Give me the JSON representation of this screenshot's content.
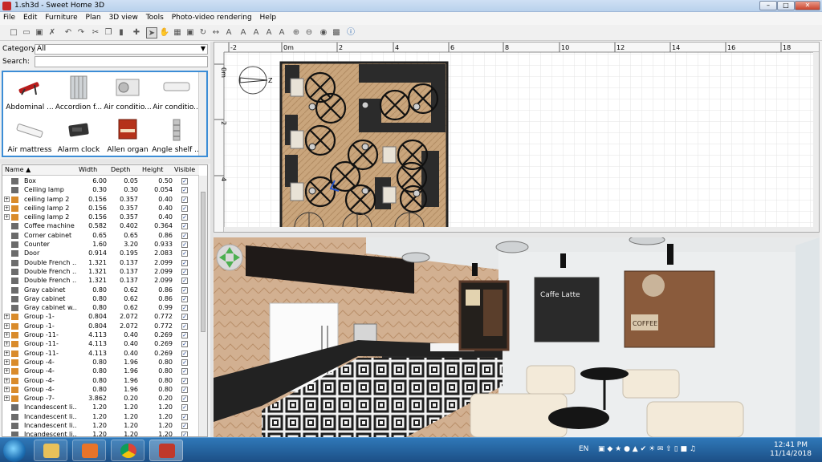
{
  "window": {
    "title": "1.sh3d - Sweet Home 3D",
    "minimize_label": "–",
    "maximize_label": "□",
    "close_label": "✕"
  },
  "menu": [
    "File",
    "Edit",
    "Furniture",
    "Plan",
    "3D view",
    "Tools",
    "Photo-video rendering",
    "Help"
  ],
  "colors": {
    "accent": "#3c8dd6",
    "plan_floor": "#c8a27a",
    "taskbar": "#1c4f86"
  },
  "catalog": {
    "category_label": "Category:",
    "category_value": "All",
    "search_label": "Search:",
    "search_value": "",
    "items": [
      {
        "label": "Abdominal ...",
        "icon": "abdominal-bench-icon"
      },
      {
        "label": "Accordion f...",
        "icon": "accordion-door-icon"
      },
      {
        "label": "Air conditio...",
        "icon": "air-conditioner-outdoor-icon"
      },
      {
        "label": "Air conditio...",
        "icon": "air-conditioner-indoor-icon"
      },
      {
        "label": "Air mattress",
        "icon": "air-mattress-icon"
      },
      {
        "label": "Alarm clock",
        "icon": "alarm-clock-icon"
      },
      {
        "label": "Allen organ",
        "icon": "organ-icon"
      },
      {
        "label": "Angle shelf ...",
        "icon": "angle-shelf-icon"
      }
    ]
  },
  "furniture_table": {
    "headers": {
      "name": "Name ▲",
      "width": "Width",
      "depth": "Depth",
      "height": "Height",
      "visible": "Visible"
    },
    "rows": [
      {
        "name": "Box",
        "width": "6.00",
        "depth": "0.05",
        "height": "0.50",
        "group": false
      },
      {
        "name": "Ceiling lamp",
        "width": "0.30",
        "depth": "0.30",
        "height": "0.054",
        "group": false
      },
      {
        "name": "ceiling lamp 2",
        "width": "0.156",
        "depth": "0.357",
        "height": "0.40",
        "group": true
      },
      {
        "name": "ceiling lamp 2",
        "width": "0.156",
        "depth": "0.357",
        "height": "0.40",
        "group": true
      },
      {
        "name": "ceiling lamp 2",
        "width": "0.156",
        "depth": "0.357",
        "height": "0.40",
        "group": true
      },
      {
        "name": "Coffee machine",
        "width": "0.582",
        "depth": "0.402",
        "height": "0.364",
        "group": false
      },
      {
        "name": "Corner cabinet",
        "width": "0.65",
        "depth": "0.65",
        "height": "0.86",
        "group": false
      },
      {
        "name": "Counter",
        "width": "1.60",
        "depth": "3.20",
        "height": "0.933",
        "group": false
      },
      {
        "name": "Door",
        "width": "0.914",
        "depth": "0.195",
        "height": "2.083",
        "group": false
      },
      {
        "name": "Double French ...",
        "width": "1.321",
        "depth": "0.137",
        "height": "2.099",
        "group": false
      },
      {
        "name": "Double French ...",
        "width": "1.321",
        "depth": "0.137",
        "height": "2.099",
        "group": false
      },
      {
        "name": "Double French ...",
        "width": "1.321",
        "depth": "0.137",
        "height": "2.099",
        "group": false
      },
      {
        "name": "Gray cabinet",
        "width": "0.80",
        "depth": "0.62",
        "height": "0.86",
        "group": false
      },
      {
        "name": "Gray cabinet",
        "width": "0.80",
        "depth": "0.62",
        "height": "0.86",
        "group": false
      },
      {
        "name": "Gray cabinet w...",
        "width": "0.80",
        "depth": "0.62",
        "height": "0.99",
        "group": false
      },
      {
        "name": "Group -1-",
        "width": "0.804",
        "depth": "2.072",
        "height": "0.772",
        "group": true
      },
      {
        "name": "Group -1-",
        "width": "0.804",
        "depth": "2.072",
        "height": "0.772",
        "group": true
      },
      {
        "name": "Group -11-",
        "width": "4.113",
        "depth": "0.40",
        "height": "0.269",
        "group": true
      },
      {
        "name": "Group -11-",
        "width": "4.113",
        "depth": "0.40",
        "height": "0.269",
        "group": true
      },
      {
        "name": "Group -11-",
        "width": "4.113",
        "depth": "0.40",
        "height": "0.269",
        "group": true
      },
      {
        "name": "Group -4-",
        "width": "0.80",
        "depth": "1.96",
        "height": "0.80",
        "group": true
      },
      {
        "name": "Group -4-",
        "width": "0.80",
        "depth": "1.96",
        "height": "0.80",
        "group": true
      },
      {
        "name": "Group -4-",
        "width": "0.80",
        "depth": "1.96",
        "height": "0.80",
        "group": true
      },
      {
        "name": "Group -4-",
        "width": "0.80",
        "depth": "1.96",
        "height": "0.80",
        "group": true
      },
      {
        "name": "Group -7-",
        "width": "3.862",
        "depth": "0.20",
        "height": "0.20",
        "group": true
      },
      {
        "name": "Incandescent li...",
        "width": "1.20",
        "depth": "1.20",
        "height": "1.20",
        "group": false
      },
      {
        "name": "Incandescent li...",
        "width": "1.20",
        "depth": "1.20",
        "height": "1.20",
        "group": false
      },
      {
        "name": "Incandescent li...",
        "width": "1.20",
        "depth": "1.20",
        "height": "1.20",
        "group": false
      },
      {
        "name": "Incandescent li...",
        "width": "1.20",
        "depth": "1.20",
        "height": "1.20",
        "group": false
      }
    ]
  },
  "plan": {
    "ruler_labels": [
      "-2",
      "0m",
      "2",
      "4",
      "6",
      "8",
      "10",
      "12",
      "14",
      "16",
      "18"
    ],
    "vruler_labels": [
      "0m",
      "2",
      "4"
    ]
  },
  "view3d": {
    "sign_left": "Caffe Latte",
    "sign_right": "COFFEE"
  },
  "taskbar": {
    "apps": [
      "file-explorer-icon",
      "media-player-icon",
      "chrome-icon",
      "sweet-home-3d-icon"
    ],
    "lang": "EN",
    "time": "12:41 PM",
    "date": "11/14/2018"
  }
}
